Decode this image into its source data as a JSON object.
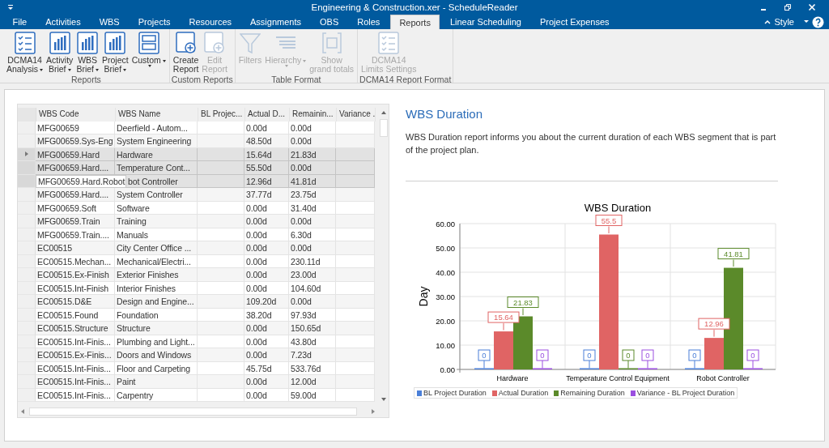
{
  "window": {
    "title": "Engineering & Construction.xer - ScheduleReader"
  },
  "tabs": [
    {
      "label": "File",
      "selected": false
    },
    {
      "label": "Activities",
      "selected": false
    },
    {
      "label": "WBS",
      "selected": false
    },
    {
      "label": "Projects",
      "selected": false
    },
    {
      "label": "Resources",
      "selected": false
    },
    {
      "label": "Assignments",
      "selected": false
    },
    {
      "label": "OBS",
      "selected": false
    },
    {
      "label": "Roles",
      "selected": false
    },
    {
      "label": "Reports",
      "selected": true
    },
    {
      "label": "Linear Scheduling",
      "selected": false
    },
    {
      "label": "Project Expenses",
      "selected": false
    }
  ],
  "style_menu": {
    "label": "Style"
  },
  "ribbon": [
    {
      "name": "Reports",
      "buttons": [
        {
          "kind": "checklist",
          "lines": [
            "DCMA14",
            "Analysis"
          ],
          "dropdown": true,
          "disabled": false
        },
        {
          "kind": "barchart",
          "lines": [
            "Activity",
            "Brief"
          ],
          "dropdown": true,
          "disabled": false
        },
        {
          "kind": "barchart",
          "lines": [
            "WBS",
            "Brief"
          ],
          "dropdown": true,
          "disabled": false
        },
        {
          "kind": "barchart",
          "lines": [
            "Project",
            "Brief"
          ],
          "dropdown": true,
          "disabled": false
        },
        {
          "kind": "layout",
          "lines": [
            "Custom"
          ],
          "dropdown": true,
          "disabled": false
        }
      ]
    },
    {
      "name": "Custom Reports",
      "buttons": [
        {
          "kind": "create",
          "lines": [
            "Create",
            "Report"
          ],
          "dropdown": false,
          "disabled": false
        },
        {
          "kind": "edit",
          "lines": [
            "Edit",
            "Report"
          ],
          "dropdown": false,
          "disabled": true
        }
      ]
    },
    {
      "name": "Table Format",
      "buttons": [
        {
          "kind": "filter",
          "lines": [
            "Filters"
          ],
          "dropdown": false,
          "disabled": true
        },
        {
          "kind": "hierarchy",
          "lines": [
            "Hierarchy"
          ],
          "dropdown": true,
          "disabled": true
        },
        {
          "kind": "totals",
          "lines": [
            "Show",
            "grand totals"
          ],
          "dropdown": false,
          "disabled": true
        }
      ]
    },
    {
      "name": "DCMA14 Report Format",
      "buttons": [
        {
          "kind": "checklist",
          "lines": [
            "DCMA14",
            "Limits Settings"
          ],
          "dropdown": false,
          "disabled": true
        }
      ]
    }
  ],
  "table": {
    "columns": [
      "WBS Code",
      "WBS Name",
      "BL Projec...",
      "Actual D...",
      "Remainin...",
      "Variance ."
    ],
    "rows": [
      {
        "cells": [
          "MFG00659",
          "Deerfield - Autom...",
          "",
          "0.00d",
          "0.00d",
          ""
        ],
        "selected": false,
        "current": false,
        "editing": false
      },
      {
        "cells": [
          "MFG00659.Sys-Eng",
          "System Engineering",
          "",
          "48.50d",
          "0.00d",
          ""
        ],
        "selected": false,
        "current": false,
        "editing": false
      },
      {
        "cells": [
          "MFG00659.Hard",
          "Hardware",
          "",
          "15.64d",
          "21.83d",
          ""
        ],
        "selected": true,
        "current": true,
        "editing": false
      },
      {
        "cells": [
          "MFG00659.Hard....",
          "Temperature Cont...",
          "",
          "55.50d",
          "0.00d",
          ""
        ],
        "selected": true,
        "current": false,
        "editing": false
      },
      {
        "cells": [
          "MFG00659.Hard.Robot",
          "bot Controller",
          "",
          "12.96d",
          "41.81d",
          ""
        ],
        "selected": true,
        "current": false,
        "editing": true
      },
      {
        "cells": [
          "MFG00659.Hard....",
          "System Controller",
          "",
          "37.77d",
          "23.75d",
          ""
        ],
        "selected": false,
        "current": false,
        "editing": false
      },
      {
        "cells": [
          "MFG00659.Soft",
          "Software",
          "",
          "0.00d",
          "31.40d",
          ""
        ],
        "selected": false,
        "current": false,
        "editing": false
      },
      {
        "cells": [
          "MFG00659.Train",
          "Training",
          "",
          "0.00d",
          "0.00d",
          ""
        ],
        "selected": false,
        "current": false,
        "editing": false
      },
      {
        "cells": [
          "MFG00659.Train....",
          "Manuals",
          "",
          "0.00d",
          "6.30d",
          ""
        ],
        "selected": false,
        "current": false,
        "editing": false
      },
      {
        "cells": [
          "EC00515",
          "City Center Office ...",
          "",
          "0.00d",
          "0.00d",
          ""
        ],
        "selected": false,
        "current": false,
        "editing": false
      },
      {
        "cells": [
          "EC00515.Mechan...",
          "Mechanical/Electri...",
          "",
          "0.00d",
          "230.11d",
          ""
        ],
        "selected": false,
        "current": false,
        "editing": false
      },
      {
        "cells": [
          "EC00515.Ex-Finish",
          "Exterior Finishes",
          "",
          "0.00d",
          "23.00d",
          ""
        ],
        "selected": false,
        "current": false,
        "editing": false
      },
      {
        "cells": [
          "EC00515.Int-Finish",
          "Interior Finishes",
          "",
          "0.00d",
          "104.60d",
          ""
        ],
        "selected": false,
        "current": false,
        "editing": false
      },
      {
        "cells": [
          "EC00515.D&E",
          "Design and Engine...",
          "",
          "109.20d",
          "0.00d",
          ""
        ],
        "selected": false,
        "current": false,
        "editing": false
      },
      {
        "cells": [
          "EC00515.Found",
          "Foundation",
          "",
          "38.20d",
          "97.93d",
          ""
        ],
        "selected": false,
        "current": false,
        "editing": false
      },
      {
        "cells": [
          "EC00515.Structure",
          "Structure",
          "",
          "0.00d",
          "150.65d",
          ""
        ],
        "selected": false,
        "current": false,
        "editing": false
      },
      {
        "cells": [
          "EC00515.Int-Finis...",
          "Plumbing and Light...",
          "",
          "0.00d",
          "43.80d",
          ""
        ],
        "selected": false,
        "current": false,
        "editing": false
      },
      {
        "cells": [
          "EC00515.Ex-Finis...",
          "Doors and Windows",
          "",
          "0.00d",
          "7.23d",
          ""
        ],
        "selected": false,
        "current": false,
        "editing": false
      },
      {
        "cells": [
          "EC00515.Int-Finis...",
          "Floor and Carpeting",
          "",
          "45.75d",
          "533.76d",
          ""
        ],
        "selected": false,
        "current": false,
        "editing": false
      },
      {
        "cells": [
          "EC00515.Int-Finis...",
          "Paint",
          "",
          "0.00d",
          "12.00d",
          ""
        ],
        "selected": false,
        "current": false,
        "editing": false
      },
      {
        "cells": [
          "EC00515.Int-Finis...",
          "Carpentry",
          "",
          "0.00d",
          "59.00d",
          ""
        ],
        "selected": false,
        "current": false,
        "editing": false
      }
    ]
  },
  "report": {
    "title": "WBS Duration",
    "description": "WBS Duration report informs you about the current duration of each WBS segment that is part of the project plan.",
    "chart_data": {
      "type": "bar",
      "title": "WBS Duration",
      "ylabel": "Day",
      "categories": [
        "Hardware",
        "Temperature Control Equipment",
        "Robot Controller"
      ],
      "series": [
        {
          "name": "BL Project Duration",
          "color": "#4a7fd8",
          "values": [
            0,
            0,
            0
          ]
        },
        {
          "name": "Actual Duration",
          "color": "#e06464",
          "values": [
            15.64,
            55.5,
            12.96
          ]
        },
        {
          "name": "Remaining Duration",
          "color": "#5b8a2a",
          "values": [
            21.83,
            0,
            41.81
          ]
        },
        {
          "name": "Variance - BL Project Duration",
          "color": "#9b4fe0",
          "values": [
            0,
            0,
            0
          ]
        }
      ],
      "ylim": [
        0,
        60
      ],
      "grid": true,
      "legend": "bottom",
      "yticks": [
        {
          "value": 0,
          "label": "0.00"
        },
        {
          "value": 10,
          "label": "10.00"
        },
        {
          "value": 20,
          "label": "20.00"
        },
        {
          "value": 30,
          "label": "30.00"
        },
        {
          "value": 40,
          "label": "40.00"
        },
        {
          "value": 50,
          "label": "50.00"
        },
        {
          "value": 60,
          "label": "60.00"
        }
      ],
      "value_labels": [
        [
          "0",
          "0",
          "0"
        ],
        [
          "15.64",
          "55.5",
          "12.96"
        ],
        [
          "21.83",
          "0",
          "41.81"
        ],
        [
          "0",
          "0",
          "0"
        ]
      ]
    }
  }
}
